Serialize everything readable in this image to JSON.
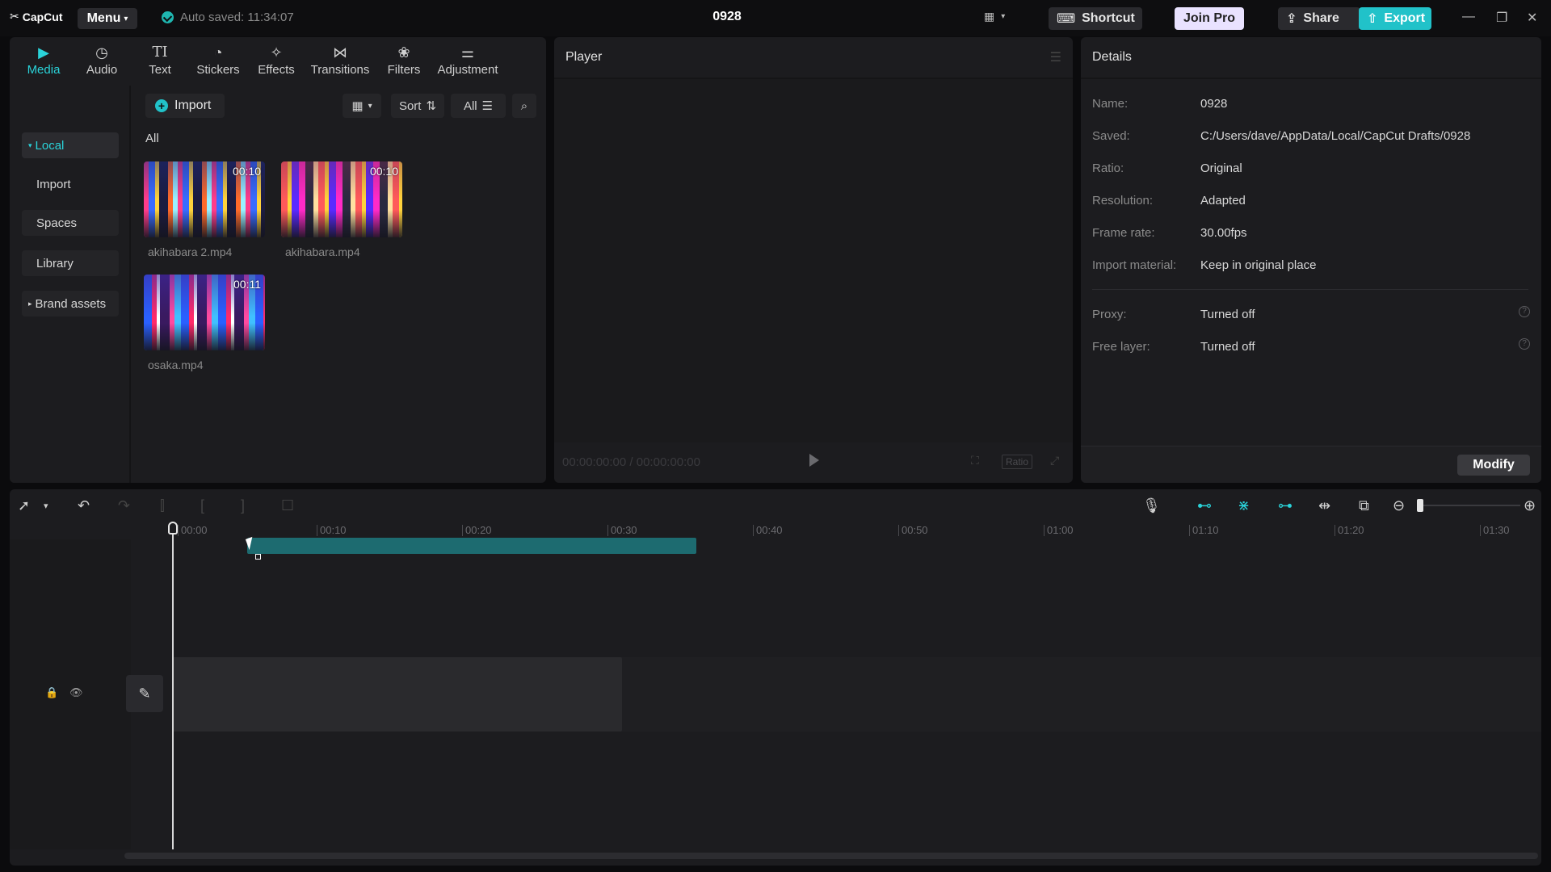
{
  "app": {
    "logo": "CapCut",
    "menu_label": "Menu",
    "autosave": "Auto saved: 11:34:07",
    "project_title": "0928",
    "shortcut_label": "Shortcut",
    "joinpro_label": "Join Pro",
    "share_label": "Share",
    "export_label": "Export"
  },
  "tooltabs": [
    {
      "label": "Media",
      "icon": "media-icon"
    },
    {
      "label": "Audio",
      "icon": "audio-icon"
    },
    {
      "label": "Text",
      "icon": "text-icon"
    },
    {
      "label": "Stickers",
      "icon": "stickers-icon"
    },
    {
      "label": "Effects",
      "icon": "effects-icon"
    },
    {
      "label": "Transitions",
      "icon": "transitions-icon"
    },
    {
      "label": "Filters",
      "icon": "filters-icon"
    },
    {
      "label": "Adjustment",
      "icon": "adjustment-icon"
    }
  ],
  "media": {
    "sidebar": {
      "local": "Local",
      "import": "Import",
      "spaces": "Spaces",
      "library": "Library",
      "brand": "Brand assets"
    },
    "import_label": "Import",
    "sort_label": "Sort",
    "filter_label": "All",
    "section_label": "All",
    "clips": [
      {
        "name": "akihabara 2.mp4",
        "duration": "00:10"
      },
      {
        "name": "akihabara.mp4",
        "duration": "00:10"
      },
      {
        "name": "osaka.mp4",
        "duration": "00:11"
      }
    ]
  },
  "player": {
    "title": "Player",
    "timecode": "00:00:00:00 / 00:00:00:00",
    "ratio_label": "Ratio"
  },
  "details": {
    "title": "Details",
    "rows": [
      {
        "label": "Name:",
        "value": "0928"
      },
      {
        "label": "Saved:",
        "value": "C:/Users/dave/AppData/Local/CapCut Drafts/0928"
      },
      {
        "label": "Ratio:",
        "value": "Original"
      },
      {
        "label": "Resolution:",
        "value": "Adapted"
      },
      {
        "label": "Frame rate:",
        "value": "30.00fps"
      },
      {
        "label": "Import material:",
        "value": "Keep in original place"
      }
    ],
    "rows2": [
      {
        "label": "Proxy:",
        "value": "Turned off"
      },
      {
        "label": "Free layer:",
        "value": "Turned off"
      }
    ],
    "modify_label": "Modify"
  },
  "timeline": {
    "ticks": [
      "00:00",
      "00:10",
      "00:20",
      "00:30",
      "00:40",
      "00:50",
      "01:00",
      "01:10",
      "01:20",
      "01:30"
    ]
  },
  "colors": {
    "accent": "#21c2c9",
    "teal_clip": "#1d6b70"
  }
}
